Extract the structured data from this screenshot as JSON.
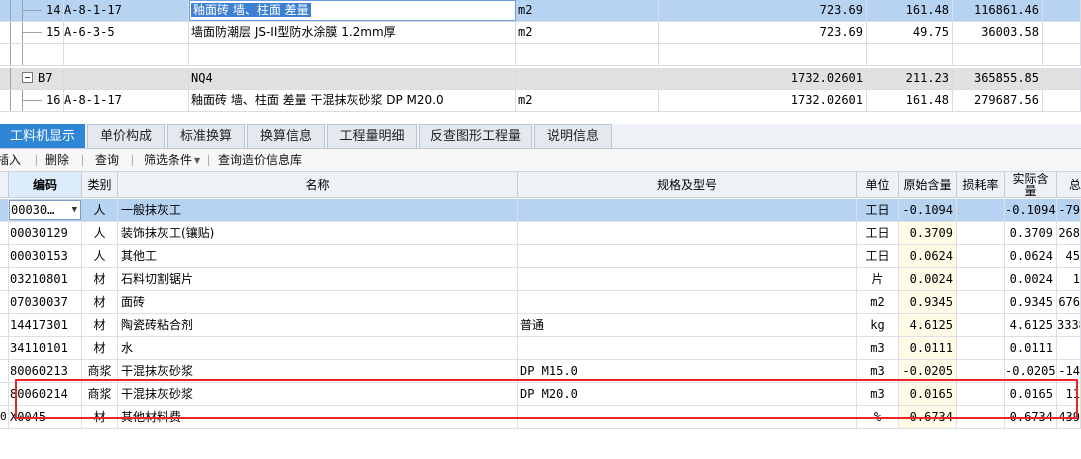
{
  "upper_rows": [
    {
      "index": "14",
      "code": "A-8-1-17",
      "name": "釉面砖 墙、柱面 差量",
      "unit": "m2",
      "quantity": "723.69",
      "price": "161.48",
      "total": "116861.46"
    },
    {
      "index": "15",
      "code": "A-6-3-5",
      "name": "墙面防潮层 JS-II型防水涂膜 1.2mm厚",
      "unit": "m2",
      "quantity": "723.69",
      "price": "49.75",
      "total": "36003.58"
    },
    {
      "index": "",
      "code": "",
      "name": "",
      "unit": "",
      "quantity": "",
      "price": "",
      "total": ""
    },
    {
      "index": "B7",
      "code": "",
      "name": "NQ4",
      "unit": "",
      "quantity": "1732.02601",
      "price": "211.23",
      "total": "365855.85"
    },
    {
      "index": "16",
      "code": "A-8-1-17",
      "name": "釉面砖 墙、柱面 差量 干混抹灰砂浆 DP M20.0",
      "unit": "m2",
      "quantity": "1732.02601",
      "price": "161.48",
      "total": "279687.56"
    }
  ],
  "tabs": [
    {
      "label": "工料机显示"
    },
    {
      "label": "单价构成"
    },
    {
      "label": "标准换算"
    },
    {
      "label": "换算信息"
    },
    {
      "label": "工程量明细"
    },
    {
      "label": "反查图形工程量"
    },
    {
      "label": "说明信息"
    }
  ],
  "toolbar": {
    "insert": "插入",
    "delete": "删除",
    "query": "查询",
    "filter": "筛选条件",
    "price_lookup": "查询造价信息库"
  },
  "columns": {
    "code": "编码",
    "category": "类别",
    "name": "名称",
    "spec": "规格及型号",
    "unit": "单位",
    "orig_qty": "原始含量",
    "loss_rate": "损耗率",
    "actual_qty": "实际含量",
    "total": "总"
  },
  "rows": [
    {
      "code": "00030…",
      "category": "人",
      "name": "一般抹灰工",
      "spec": "",
      "unit": "工日",
      "orig": "-0.1094",
      "loss": "",
      "actual": "-0.1094",
      "total": "-79"
    },
    {
      "code": "00030129",
      "category": "人",
      "name": "装饰抹灰工(镶贴)",
      "spec": "",
      "unit": "工日",
      "orig": "0.3709",
      "loss": "",
      "actual": "0.3709",
      "total": "268"
    },
    {
      "code": "00030153",
      "category": "人",
      "name": "其他工",
      "spec": "",
      "unit": "工日",
      "orig": "0.0624",
      "loss": "",
      "actual": "0.0624",
      "total": "45"
    },
    {
      "code": "03210801",
      "category": "材",
      "name": "石料切割锯片",
      "spec": "",
      "unit": "片",
      "orig": "0.0024",
      "loss": "",
      "actual": "0.0024",
      "total": "1"
    },
    {
      "code": "07030037",
      "category": "材",
      "name": "面砖",
      "spec": "",
      "unit": "m2",
      "orig": "0.9345",
      "loss": "",
      "actual": "0.9345",
      "total": "676"
    },
    {
      "code": "14417301",
      "category": "材",
      "name": "陶瓷砖粘合剂",
      "spec": "普通",
      "unit": "kg",
      "orig": "4.6125",
      "loss": "",
      "actual": "4.6125",
      "total": "3338"
    },
    {
      "code": "34110101",
      "category": "材",
      "name": "水",
      "spec": "",
      "unit": "m3",
      "orig": "0.0111",
      "loss": "",
      "actual": "0.0111",
      "total": ""
    },
    {
      "code": "80060213",
      "category": "商浆",
      "name": "干混抹灰砂浆",
      "spec": "DP M15.0",
      "unit": "m3",
      "orig": "-0.0205",
      "loss": "",
      "actual": "-0.0205",
      "total": "-14"
    },
    {
      "code": "80060214",
      "category": "商浆",
      "name": "干混抹灰砂浆",
      "spec": "DP M20.0",
      "unit": "m3",
      "orig": "0.0165",
      "loss": "",
      "actual": "0.0165",
      "total": "11"
    },
    {
      "code": "X0045",
      "category": "材",
      "name": "其他材料费",
      "spec": "",
      "unit": "%",
      "orig": "0.6734",
      "loss": "",
      "actual": "0.6734",
      "total": "439"
    }
  ],
  "last_row_index": "0",
  "colors": {
    "selected_row": "#b7d3f2",
    "active_tab": "#2f86d6",
    "annotation_box": "#e8252a"
  }
}
